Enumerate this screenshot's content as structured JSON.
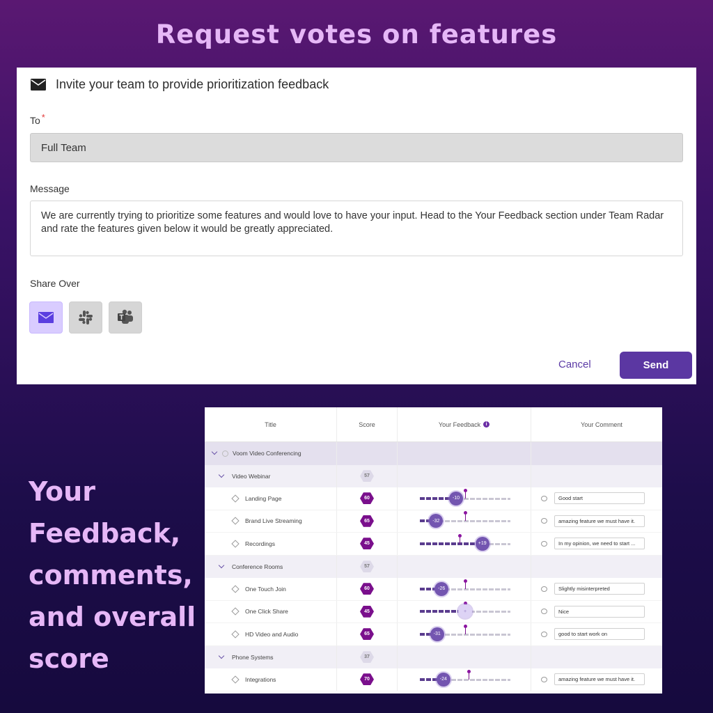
{
  "headline": "Request votes on features",
  "dialog": {
    "title": "Invite your team to provide prioritization feedback",
    "to_label": "To",
    "to_value": "Full Team",
    "message_label": "Message",
    "message_value": "We are currently trying to prioritize some features and would love to have your input. Head to the Your Feedback section under Team Radar and rate the features given below it would be greatly appreciated.",
    "share_label": "Share Over",
    "share_options": [
      {
        "icon": "email-icon",
        "active": true
      },
      {
        "icon": "slack-icon",
        "active": false
      },
      {
        "icon": "teams-icon",
        "active": false
      }
    ],
    "cancel_label": "Cancel",
    "send_label": "Send"
  },
  "caption": [
    "Your",
    "Feedback,",
    "comments,",
    "and overall",
    "score"
  ],
  "table": {
    "headers": [
      "Title",
      "Score",
      "Your Feedback",
      "Your Comment"
    ],
    "rows": [
      {
        "level": 0,
        "title": "Voom Video Conferencing",
        "score": "",
        "feedback": null,
        "comment": ""
      },
      {
        "level": 1,
        "title": "Video Webinar",
        "score": "57",
        "feedback": null,
        "comment": ""
      },
      {
        "level": 2,
        "title": "Landing Page",
        "score": "60",
        "feedback": -10,
        "avg": 0,
        "comment": "Good start"
      },
      {
        "level": 2,
        "title": "Brand Live Streaming",
        "score": "65",
        "feedback": -32,
        "avg": 0,
        "comment": "amazing feature we must have it."
      },
      {
        "level": 2,
        "title": "Recordings",
        "score": "45",
        "feedback": 19,
        "avg": -6,
        "comment": "In my opinion, we need to start ..."
      },
      {
        "level": 1,
        "title": "Conference Rooms",
        "score": "57",
        "feedback": null,
        "comment": ""
      },
      {
        "level": 2,
        "title": "One Touch Join",
        "score": "60",
        "feedback": -26,
        "avg": 0,
        "comment": "Slightly misinterpreted"
      },
      {
        "level": 2,
        "title": "One Click Share",
        "score": "45",
        "feedback": 0,
        "avg": 0,
        "comment": "Nice"
      },
      {
        "level": 2,
        "title": "HD Video and Audio",
        "score": "65",
        "feedback": -31,
        "avg": 0,
        "comment": "good to start work on"
      },
      {
        "level": 1,
        "title": "Phone Systems",
        "score": "37",
        "feedback": null,
        "comment": ""
      },
      {
        "level": 2,
        "title": "Integrations",
        "score": "70",
        "feedback": -24,
        "avg": 4,
        "comment": "amazing feature we must have it."
      }
    ]
  },
  "colors": {
    "accent": "#5b37a2",
    "score_hex": "#7a0f8c",
    "headline": "#e6b7f7"
  }
}
